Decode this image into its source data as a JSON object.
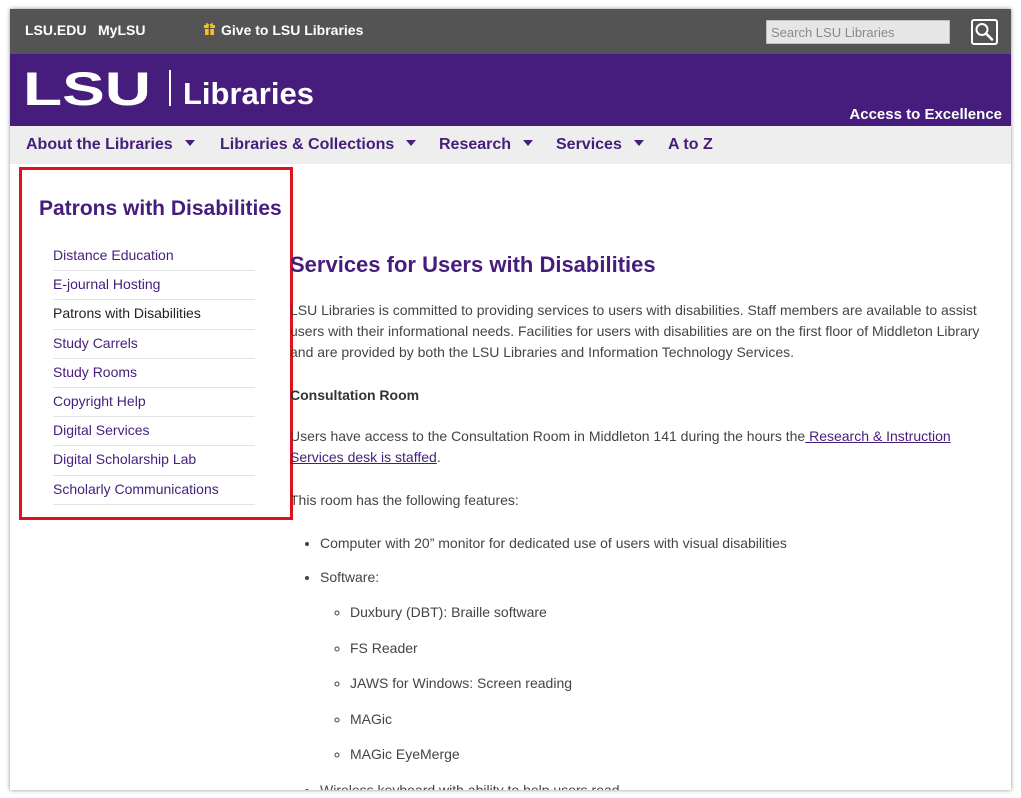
{
  "topbar": {
    "links": [
      "LSU.EDU",
      "MyLSU"
    ],
    "give_label": "Give to LSU Libraries",
    "search_placeholder": "Search LSU Libraries"
  },
  "brand": {
    "logo_text": "LSU",
    "section": "Libraries",
    "tagline": "Access to Excellence",
    "colors": {
      "purple": "#461d7c",
      "utility_gray": "#545454",
      "nav_gray": "#eeeeee",
      "highlight_red": "#e0111b",
      "gift_gold": "#f5c224"
    }
  },
  "nav": {
    "items": [
      "About the Libraries",
      "Libraries & Collections",
      "Research",
      "Services",
      "A to Z"
    ]
  },
  "sidebar": {
    "title": "Patrons with Disabilities",
    "items": [
      "Distance Education",
      "E-journal Hosting",
      "Patrons with Disabilities",
      "Study Carrels",
      "Study Rooms",
      "Copyright Help",
      "Digital Services",
      "Digital Scholarship Lab",
      "Scholarly Communications"
    ],
    "current_item": "Patrons with Disabilities"
  },
  "main": {
    "title": "Services for Users with Disabilities",
    "intro": "LSU Libraries is committed to providing services to users with disabilities.  Staff members are available to assist users with their informational needs. Facilities for users with disabilities are on the first floor of Middleton Library and are provided by both the LSU Libraries and Information Technology Services.",
    "consultation_heading": "Consultation Room",
    "access_text": "Users have access to the Consultation Room in Middleton 141 during the hours the",
    "access_link": " Research & Instruction Services desk is staffed",
    "access_end": ".",
    "features_intro": "This room has the following features:",
    "features": [
      "Computer with 20” monitor for dedicated use of users with visual disabilities",
      "Software:",
      "Wireless keyboard with ability to help users read"
    ],
    "software": [
      "Duxbury (DBT): Braille software",
      "FS Reader",
      "JAWS for Windows: Screen reading",
      "MAGic",
      "MAGic EyeMerge"
    ]
  }
}
